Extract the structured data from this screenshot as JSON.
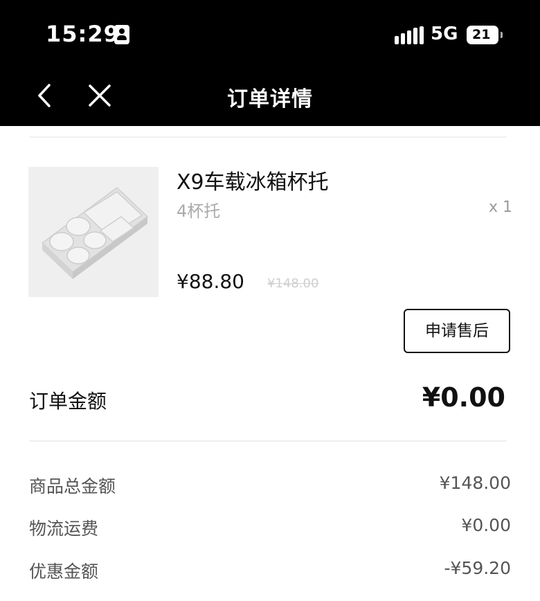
{
  "status_bar": {
    "time": "15:29",
    "network": "5G",
    "battery": "21"
  },
  "nav": {
    "title": "订单详情"
  },
  "product": {
    "name": "X9车载冰箱杯托",
    "spec": "4杯托",
    "quantity": "x 1",
    "price": "¥88.80",
    "original_price": "¥148.00",
    "after_sale_label": "申请售后"
  },
  "order": {
    "amount_label": "订单金额",
    "amount_value": "¥0.00"
  },
  "summary": [
    {
      "label": "商品总金额",
      "value": "¥148.00"
    },
    {
      "label": "物流运费",
      "value": "¥0.00"
    },
    {
      "label": "优惠金额",
      "value": "-¥59.20"
    }
  ],
  "colors": {
    "header_bg": "#000000",
    "page_bg": "#ffffff",
    "muted_text": "#aaaaaa"
  }
}
